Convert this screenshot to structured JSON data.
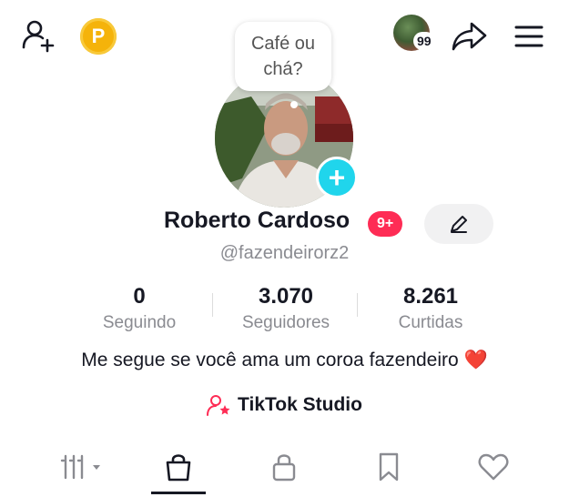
{
  "header": {
    "add_user_icon": "add-user-icon",
    "coin_letter": "P",
    "coin_color": "#f5b30a",
    "friends_count": "99",
    "share_icon": "share-icon",
    "menu_icon": "hamburger-menu-icon"
  },
  "profile": {
    "bubble_text": "Café ou chá?",
    "name": "Roberto Cardoso",
    "notification_badge": "9+",
    "username": "@fazendeirorz2",
    "bio_text": "Me segue se você ama um coroa fazendeiro ",
    "bio_emoji": "❤️",
    "studio_label": "TikTok Studio"
  },
  "stats": [
    {
      "value": "0",
      "label": "Seguindo"
    },
    {
      "value": "3.070",
      "label": "Seguidores"
    },
    {
      "value": "8.261",
      "label": "Curtidas"
    }
  ],
  "tabs": {
    "active": "shop",
    "items": [
      "grid",
      "shop",
      "private",
      "saved",
      "liked"
    ]
  },
  "colors": {
    "accent_red": "#fe2c55",
    "cyan": "#20d5ec",
    "text_primary": "#161823",
    "text_secondary": "#8a8b91",
    "heart": "#e0322f"
  }
}
